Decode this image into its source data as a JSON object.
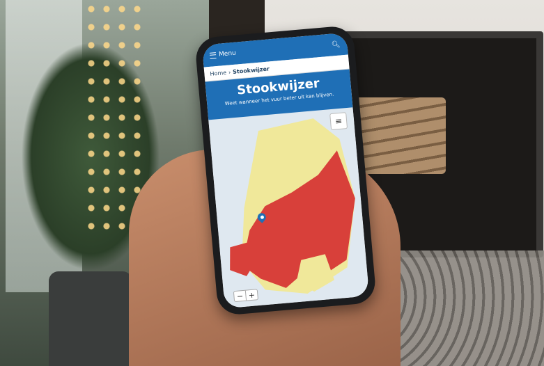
{
  "app": {
    "menu_label": "Menu",
    "search_icon": "search-icon",
    "menu_icon": "hamburger-icon"
  },
  "breadcrumb": {
    "home": "Home",
    "separator": "›",
    "current": "Stookwijzer"
  },
  "hero": {
    "title": "Stookwijzer",
    "subtitle": "Weet wanneer het vuur beter uit kan blijven."
  },
  "map": {
    "layers_icon": "layers-icon",
    "zoom_in": "+",
    "zoom_out": "−",
    "pin_icon": "location-pin-icon",
    "colors": {
      "water": "#dfe8f0",
      "safe": "#f0e89a",
      "warning": "#d8403a"
    }
  },
  "colors": {
    "brand_blue": "#1f6fb6"
  }
}
